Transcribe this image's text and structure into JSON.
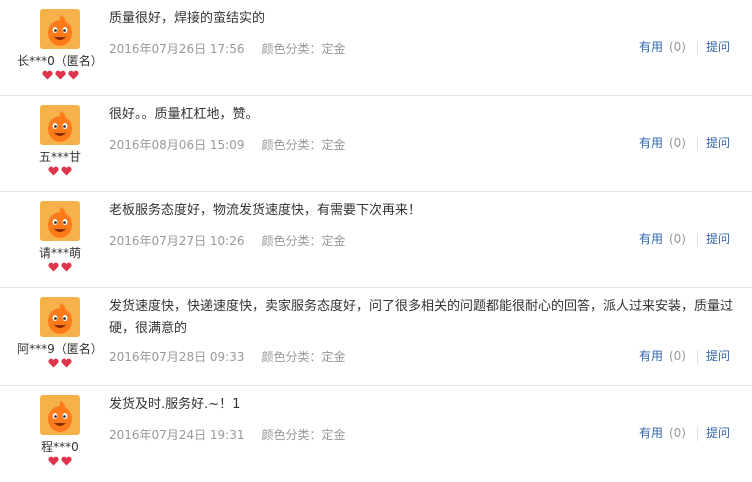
{
  "reviews": [
    {
      "user": "长***0（匿名）",
      "text": "质量很好，焊接的蛮结实的",
      "date": "2016年07月26日 17:56",
      "color_label": "颜色分类：定金",
      "useful": "有用",
      "count": "(0)",
      "ask": "提问",
      "hearts": 3
    },
    {
      "user": "五***甘",
      "text": "很好。。质量杠杠地，赞。",
      "date": "2016年08月06日 15:09",
      "color_label": "颜色分类：定金",
      "useful": "有用",
      "count": "(0)",
      "ask": "提问",
      "hearts": 2
    },
    {
      "user": "请***萌",
      "text": "老板服务态度好，物流发货速度快，有需要下次再来！",
      "date": "2016年07月27日 10:26",
      "color_label": "颜色分类：定金",
      "useful": "有用",
      "count": "(0)",
      "ask": "提问",
      "hearts": 2
    },
    {
      "user": "阿***9（匿名）",
      "text": "发货速度快，快递速度快，卖家服务态度好，问了很多相关的问题都能很耐心的回答，派人过来安装，质量过硬，很满意的",
      "date": "2016年07月28日 09:33",
      "color_label": "颜色分类：定金",
      "useful": "有用",
      "count": "(0)",
      "ask": "提问",
      "hearts": 2
    },
    {
      "user": "程***0",
      "text": "发货及时.服务好.~！1",
      "date": "2016年07月24日 19:31",
      "color_label": "颜色分类：定金",
      "useful": "有用",
      "count": "(0)",
      "ask": "提问",
      "hearts": 2
    }
  ],
  "colors": {
    "link": "#3366aa",
    "muted": "#999999",
    "avatar_bg": "#f6b24a",
    "heart": "#e0344a"
  }
}
